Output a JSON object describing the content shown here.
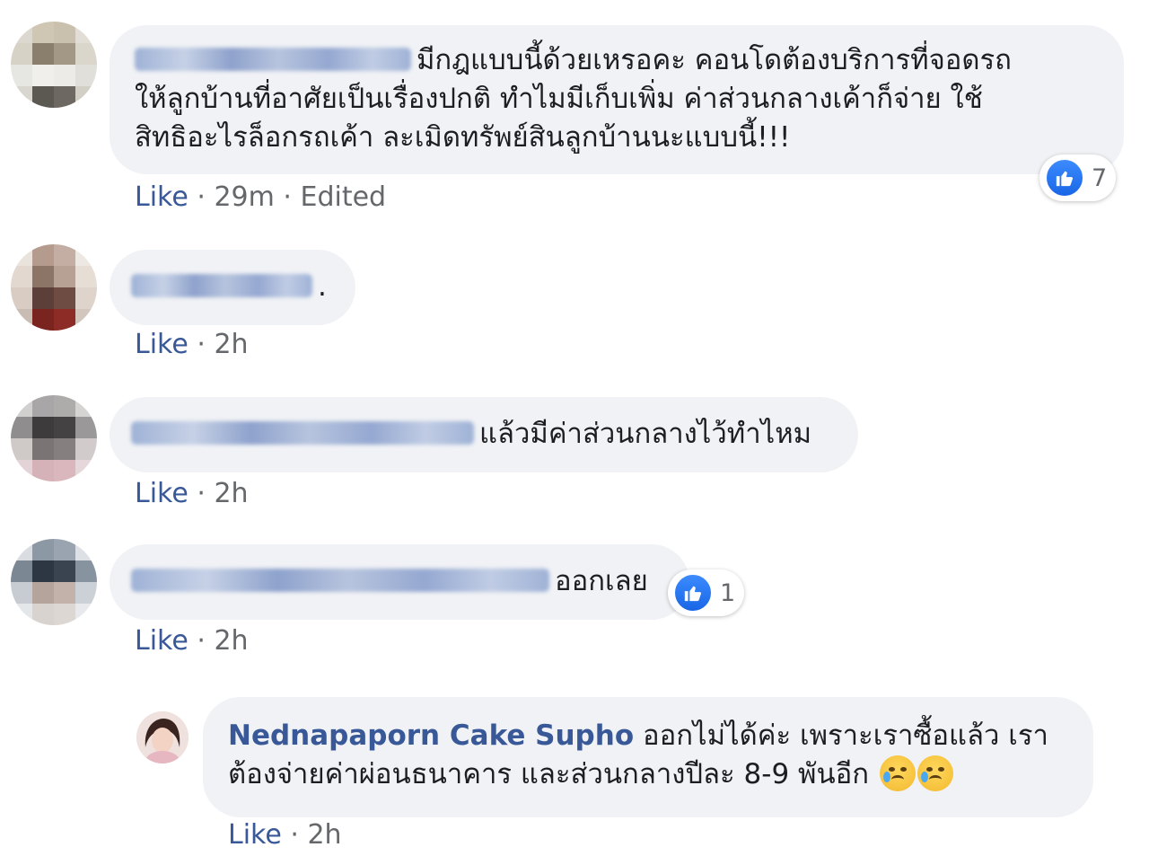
{
  "comments": [
    {
      "author": "",
      "text_lines": [
        "มีกฎแบบนี้ด้วยเหรอคะ คอนโดต้องบริการที่จอดรถ",
        "ให้ลูกบ้านที่อาศัยเป็นเรื่องปกติ ทำไมมีเก็บเพิ่ม ค่าส่วนกลางเค้าก็จ่าย ใช้",
        "สิทธิอะไรล็อกรถเค้า ละเมิดทรัพย์สินลูกบ้านนะแบบนี้!!!"
      ],
      "like_label": "Like",
      "time": "29m",
      "edited": "Edited",
      "reaction_count": "7"
    },
    {
      "author": "",
      "text": ".",
      "like_label": "Like",
      "time": "2h"
    },
    {
      "author": "",
      "text": "แล้วมีค่าส่วนกลางไว้ทำไหม",
      "like_label": "Like",
      "time": "2h"
    },
    {
      "author": "",
      "text": "ออกเลย",
      "like_label": "Like",
      "time": "2h",
      "reaction_count": "1"
    }
  ],
  "reply": {
    "author": "Nednapaporn Cake Supho",
    "text_line1": "ออกไม่ได้ค่ะ เพราะเราซื้อแล้ว เรา",
    "text_line2": "ต้องจ่ายค่าผ่อนธนาคาร และส่วนกลางปีละ 8-9 พันอีก",
    "like_label": "Like",
    "time": "2h",
    "emoji": "crying-face-emoji"
  },
  "separator": "·",
  "colors": {
    "bubble": "#f0f2f5",
    "name": "#385898",
    "meta": "#65676b",
    "like_thumb": "#1877f2"
  }
}
